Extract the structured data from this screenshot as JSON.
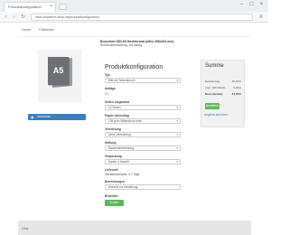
{
  "browser": {
    "tab_title": "Produktkonfiguration",
    "tab_close": "×",
    "url": "www.druckerei-shop.de/produktkonfiguration",
    "back_icon": "‹",
    "forward_icon": "›",
    "reload_icon": "↻",
    "menu_icon": "≡",
    "minimize_icon": "–",
    "maximize_icon": "□",
    "close_icon": "×"
  },
  "breadcrumb": [
    "Home",
    "Faltkarten"
  ],
  "product": {
    "image_label": "A5",
    "name": "Broschüre DIN A5 Hochformat (offen 296x210 mm)",
    "subtitle": "Rückenstichheftung, 4/4-farbig",
    "button_label": "Vorschau"
  },
  "config": {
    "title": "Produktkonfiguration",
    "fields": [
      {
        "label": "Typ",
        "value": "Bild mit Textumbruch"
      },
      {
        "label": "Auflage",
        "value": "10",
        "plain": true
      },
      {
        "label": "Seiten insgesamt",
        "value": "12 Seiten"
      },
      {
        "label": "Papier Umschlag",
        "value": "135 g/m² Bilderdruck matt"
      },
      {
        "label": "Veredelung",
        "value": "keine Veredelung"
      },
      {
        "label": "Heftung",
        "value": "Rückenstichheftung"
      },
      {
        "label": "Verpackung",
        "value": "Karton 1 Ansicht"
      }
    ],
    "delivery_label": "Lieferzeit",
    "delivery_value": "Standardversand, 3-7 Tage",
    "note_label": "Bemerkungen",
    "note_value": "Hinweis zur Bestellung",
    "submit_label": "In den Warenkorb"
  },
  "summary": {
    "title": "Summe",
    "rows": [
      {
        "label": "Nettobetrag",
        "value": "35,00 €"
      },
      {
        "label": "zzgl. 19% MwSt.",
        "value": "6,65 €"
      },
      {
        "label": "Preis (brutto)",
        "value": "41,65 €"
      }
    ],
    "button_label": "Bestellen",
    "link_label": "Angebot anfordern"
  },
  "footer": {
    "text": "Infos"
  }
}
